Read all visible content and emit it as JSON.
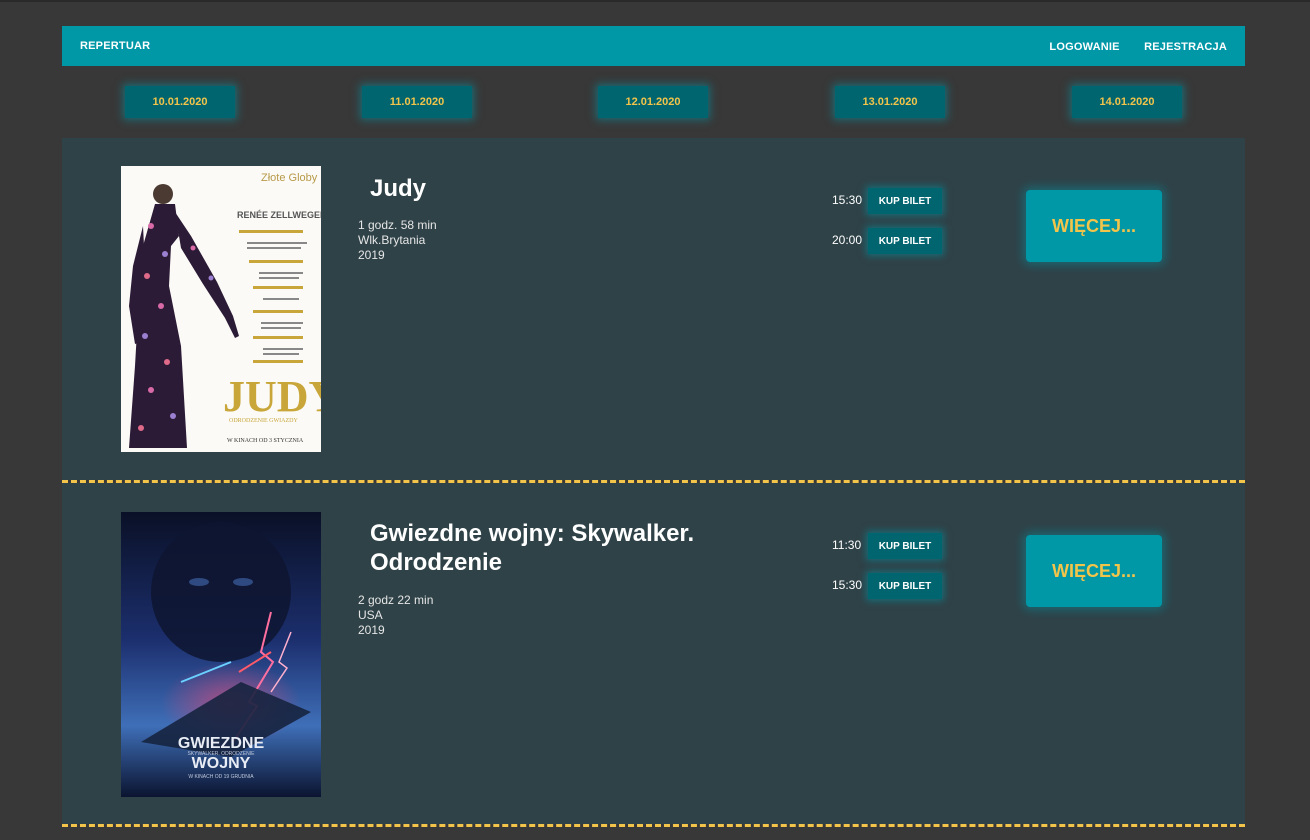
{
  "nav": {
    "repertuar": "REPERTUAR",
    "login": "LOGOWANIE",
    "register": "REJESTRACJA"
  },
  "dates": [
    "10.01.2020",
    "11.01.2020",
    "12.01.2020",
    "13.01.2020",
    "14.01.2020"
  ],
  "movies": [
    {
      "title": "Judy",
      "duration": "1 godz. 58 min",
      "country": "Wlk.Brytania",
      "year": "2019",
      "showtimes": [
        {
          "time": "15:30",
          "button": "KUP BILET"
        },
        {
          "time": "20:00",
          "button": "KUP BILET"
        }
      ],
      "more": "WIĘCEJ...",
      "poster": {
        "top_text": "Złote Globy",
        "actor": "RENÉE ZELLWEGER",
        "title": "JUDY",
        "subtitle": "ODRODZENIE GWIAZDY",
        "release": "W KINACH OD 3 STYCZNIA"
      }
    },
    {
      "title": "Gwiezdne wojny: Skywalker. Odrodzenie",
      "duration": "2 godz 22 min",
      "country": "USA",
      "year": "2019",
      "showtimes": [
        {
          "time": "11:30",
          "button": "KUP BILET"
        },
        {
          "time": "15:30",
          "button": "KUP BILET"
        }
      ],
      "more": "WIĘCEJ...",
      "poster": {
        "title_line1": "GWIEZDNE",
        "title_small": "SKYWALKER. ODRODZENIE",
        "title_line2": "WOJNY",
        "release": "W KINACH OD 19 GRUDNIA"
      }
    }
  ]
}
